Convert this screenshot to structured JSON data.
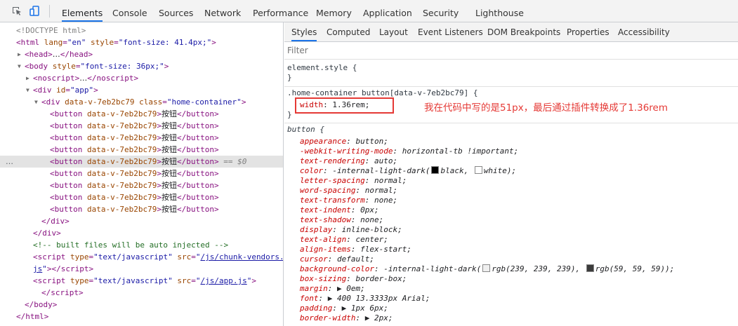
{
  "toolbar": {
    "tabs": [
      "Elements",
      "Console",
      "Sources",
      "Network",
      "Performance",
      "Memory",
      "Application",
      "Security",
      "Lighthouse"
    ],
    "active_tab": "Elements"
  },
  "dom": {
    "doctype": "<!DOCTYPE html>",
    "html_tag": "html",
    "html_attr_lang": "lang",
    "html_lang": "\"en\"",
    "html_attr_style": "style",
    "html_style": "\"font-size: 41.4px;\"",
    "head": "head",
    "body_tag": "body",
    "body_attr": "style",
    "body_style": "\"font-size: 36px;\"",
    "noscript": "noscript",
    "div_tag": "div",
    "app_attr": "id",
    "app_id": "\"app\"",
    "container_attr": "data-v-7eb2bc79",
    "container_class_attr": "class",
    "container_class": "\"home-container\"",
    "button_tag": "button",
    "button_attr": "data-v-7eb2bc79",
    "button_text": "按钮",
    "button_count": 9,
    "selected_marker": "== $0",
    "comment": "<!-- built files will be auto injected -->",
    "script_tag": "script",
    "script_type_attr": "type",
    "script_type": "\"text/javascript\"",
    "script_src_attr": "src",
    "script1_src_part1": "/js/chunk-vendors.",
    "script1_src_part2": "js",
    "script2_src": "/js/app.js"
  },
  "styles": {
    "subtabs": [
      "Styles",
      "Computed",
      "Layout",
      "Event Listeners",
      "DOM Breakpoints",
      "Properties",
      "Accessibility"
    ],
    "active_subtab": "Styles",
    "filter_placeholder": "Filter",
    "element_style": "element.style {",
    "close_brace": "}",
    "rule1_selector": ".home-container button[data-v-7eb2bc79] {",
    "rule1_prop": "width",
    "rule1_value": "1.36rem;",
    "annotation": "我在代码中写的是51px，最后通过插件转换成了1.36rem",
    "ua_selector": "button {",
    "ua_props": [
      {
        "name": "appearance",
        "value": "button;"
      },
      {
        "name": "-webkit-writing-mode",
        "value": "horizontal-tb !important;"
      },
      {
        "name": "text-rendering",
        "value": "auto;"
      },
      {
        "name": "color",
        "value_pre": "-internal-light-dark(",
        "sw1": "#000000",
        "v1": "black, ",
        "sw2": "#ffffff",
        "v2": "white);"
      },
      {
        "name": "letter-spacing",
        "value": "normal;"
      },
      {
        "name": "word-spacing",
        "value": "normal;"
      },
      {
        "name": "text-transform",
        "value": "none;"
      },
      {
        "name": "text-indent",
        "value": "0px;"
      },
      {
        "name": "text-shadow",
        "value": "none;"
      },
      {
        "name": "display",
        "value": "inline-block;"
      },
      {
        "name": "text-align",
        "value": "center;"
      },
      {
        "name": "align-items",
        "value": "flex-start;"
      },
      {
        "name": "cursor",
        "value": "default;"
      },
      {
        "name": "background-color",
        "value_pre": "-internal-light-dark(",
        "sw1": "#efefef",
        "v1": "rgb(239, 239, 239), ",
        "sw2": "#3b3b3b",
        "v2": "rgb(59, 59, 59));"
      },
      {
        "name": "box-sizing",
        "value": "border-box;"
      },
      {
        "name": "margin",
        "value": "▶ 0em;"
      },
      {
        "name": "font",
        "value": "▶ 400 13.3333px Arial;"
      },
      {
        "name": "padding",
        "value": "▶ 1px 6px;"
      },
      {
        "name": "border-width",
        "value": "▶ 2px;"
      }
    ]
  },
  "colors": {
    "accent": "#1a73e8",
    "annotation_red": "#e53935",
    "tag": "#881280",
    "attr": "#994500",
    "value": "#1a1aa6"
  }
}
